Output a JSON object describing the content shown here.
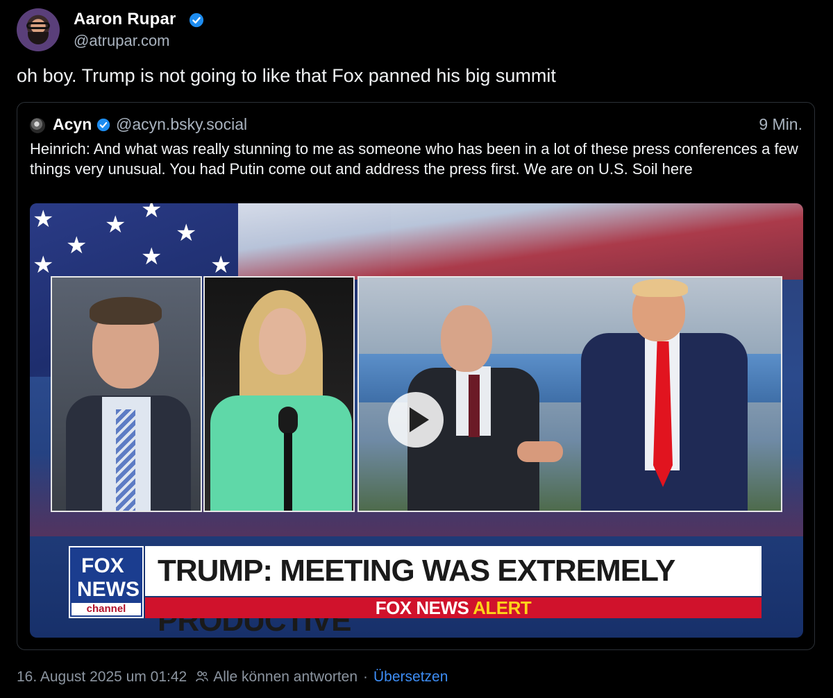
{
  "post": {
    "author": {
      "display_name": "Aaron Rupar",
      "handle": "@atrupar.com",
      "verified": true
    },
    "text": "oh boy. Trump is not going to like that Fox panned his big summit",
    "timestamp": "16. August 2025 um 01:42",
    "reply_setting": "Alle können antworten",
    "translate_label": "Übersetzen"
  },
  "quote": {
    "author": {
      "display_name": "Acyn",
      "handle": "@acyn.bsky.social",
      "verified": true
    },
    "time_ago": "9 Min.",
    "text": "Heinrich: And what was really stunning to me as someone who has been in a lot of these press conferences a few things very unusual. You had Putin come out and address the press first. We are on U.S. Soil here"
  },
  "video": {
    "chyron_headline": "TRUMP: MEETING WAS EXTREMELY PRODUCTIVE",
    "chyron_alert_white": "FOX NEWS",
    "chyron_alert_yellow": "ALERT",
    "logo_line1": "FOX",
    "logo_line2": "NEWS",
    "logo_line3": "channel"
  },
  "colors": {
    "background": "#000000",
    "link_blue": "#3d8df5",
    "muted_text": "#8c95a0",
    "verified_blue": "#1d8cf0",
    "fox_red": "#d0122c",
    "fox_blue": "#1b3d8f",
    "alert_yellow": "#ffd21a"
  },
  "icons": [
    "verified-badge-icon",
    "play-icon",
    "people-icon"
  ]
}
